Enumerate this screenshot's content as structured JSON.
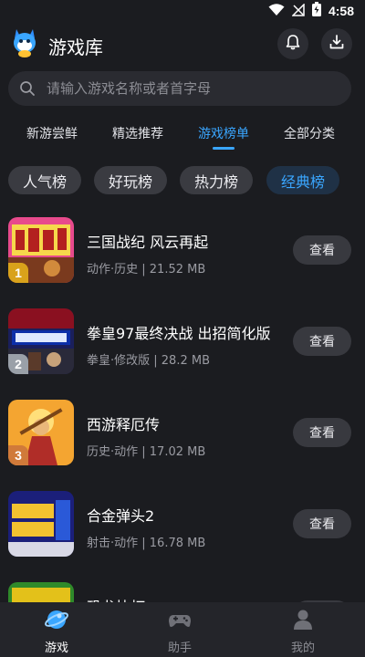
{
  "status_bar": {
    "time": "4:58"
  },
  "header": {
    "title": "游戏库",
    "icons": [
      "app-logo",
      "bell-icon",
      "download-icon"
    ]
  },
  "search": {
    "placeholder": "请输入游戏名称或者首字母"
  },
  "tabs": [
    {
      "label": "新游尝鲜"
    },
    {
      "label": "精选推荐"
    },
    {
      "label": "游戏榜单",
      "active": true
    },
    {
      "label": "全部分类"
    }
  ],
  "chips": [
    {
      "label": "人气榜"
    },
    {
      "label": "好玩榜"
    },
    {
      "label": "热力榜"
    },
    {
      "label": "经典榜",
      "active": true
    }
  ],
  "games": [
    {
      "rank": "1",
      "title": "三国战纪 风云再起",
      "meta": "动作·历史 | 21.52 MB",
      "button": "查看"
    },
    {
      "rank": "2",
      "title": "拳皇97最终决战 出招简化版",
      "meta": "拳皇·修改版 | 28.2 MB",
      "button": "查看"
    },
    {
      "rank": "3",
      "title": "西游释厄传",
      "meta": "历史·动作 | 17.02 MB",
      "button": "查看"
    },
    {
      "rank": "",
      "title": "合金弹头2",
      "meta": "射击·动作 | 16.78 MB",
      "button": "查看"
    },
    {
      "rank": "",
      "title": "恐龙快打",
      "meta": "",
      "button": "查看"
    }
  ],
  "bottom_nav": [
    {
      "label": "游戏",
      "active": true
    },
    {
      "label": "助手"
    },
    {
      "label": "我的"
    }
  ],
  "colors": {
    "accent": "#3aa6ff",
    "background": "#1b1c20",
    "rank1": "#d9a21b",
    "rank2": "#9aa0a8",
    "rank3": "#d07a3a"
  }
}
